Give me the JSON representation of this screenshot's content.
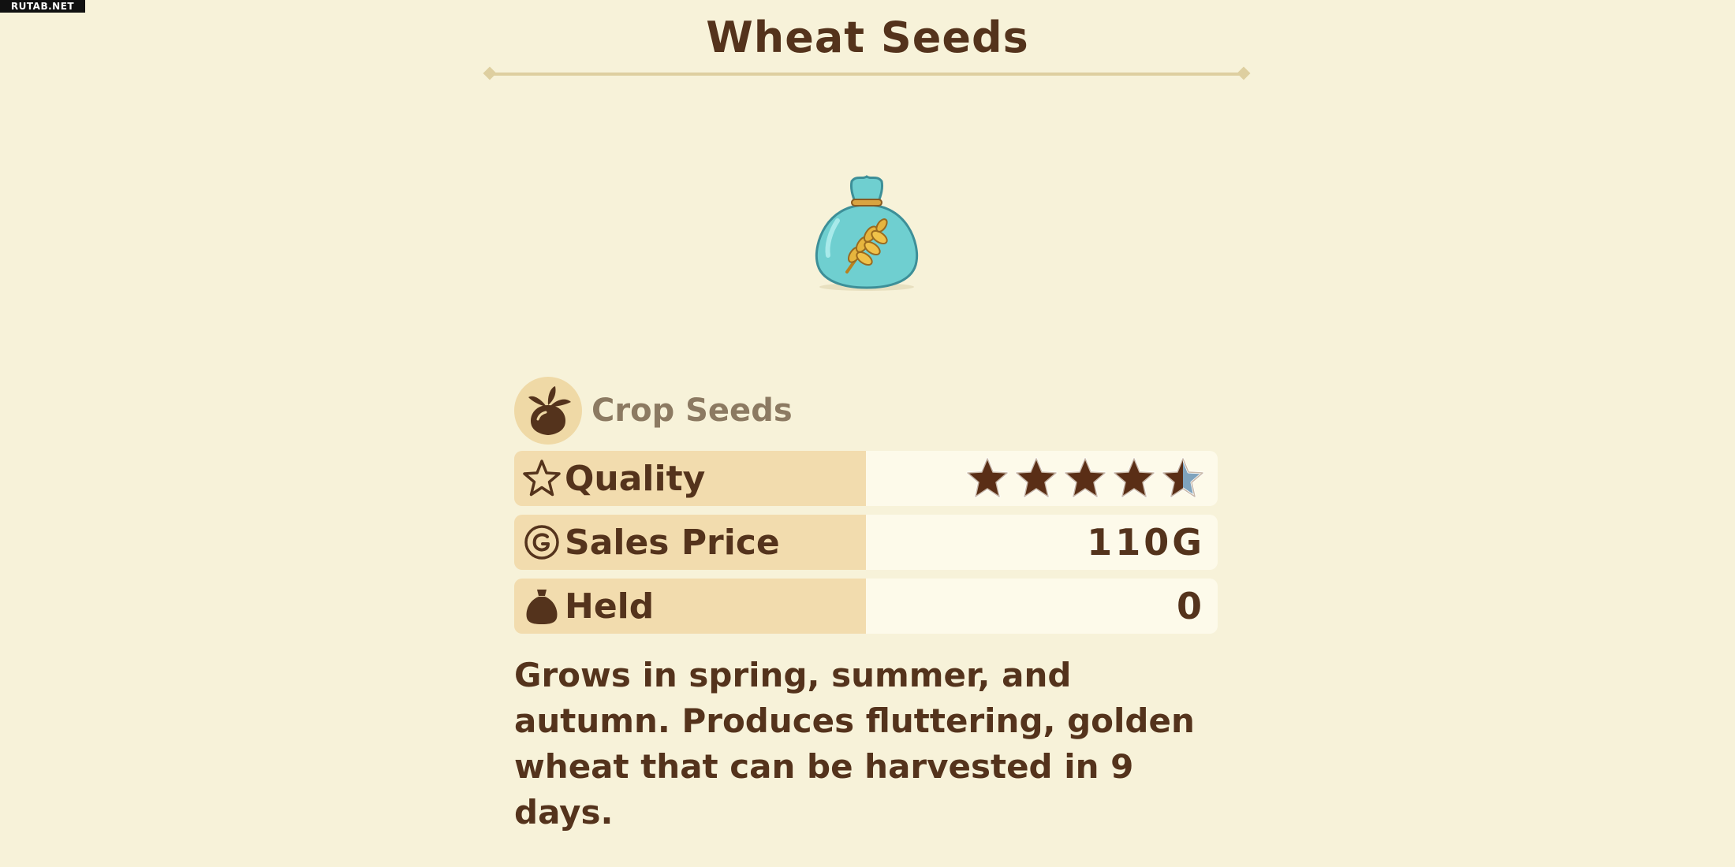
{
  "watermark": "RUTAB.NET",
  "item": {
    "title": "Wheat Seeds",
    "icon": "seed-bag-wheat-icon",
    "category": "Crop Seeds",
    "category_icon": "turnip-icon"
  },
  "stats": {
    "quality": {
      "label": "Quality",
      "icon": "star-outline-icon",
      "stars": 4.5,
      "max_stars": 5
    },
    "sales_price": {
      "label": "Sales Price",
      "icon": "gold-coin-icon",
      "value": "110G"
    },
    "held": {
      "label": "Held",
      "icon": "bag-icon",
      "value": "0"
    }
  },
  "description": "Grows in spring, summer, and autumn. Produces fluttering, golden wheat that can be harvested in 9 days.",
  "colors": {
    "background": "#f7f2d9",
    "text": "#54331c",
    "label_bg": "#f2dcae",
    "value_bg": "#fdfaea",
    "bag_teal": "#6fcfd0",
    "accent_gold": "#d9c08a"
  }
}
